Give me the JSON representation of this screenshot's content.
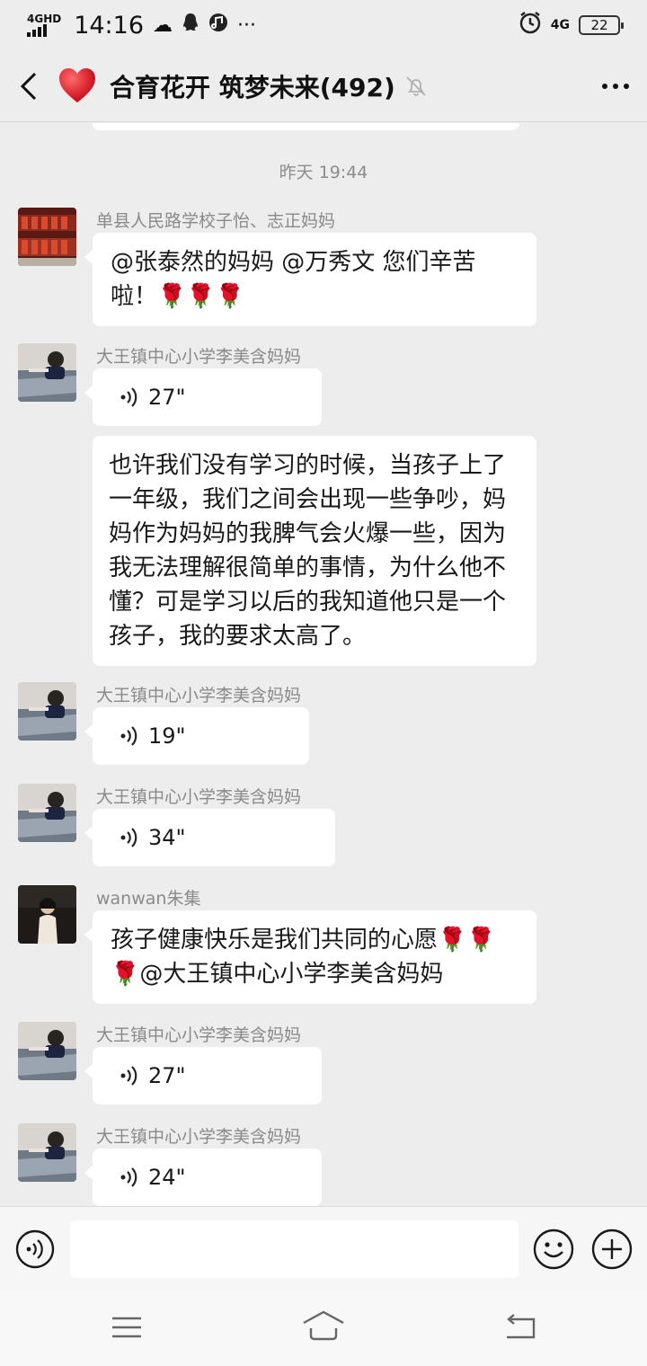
{
  "status_bar": {
    "network": "4GHD",
    "time": "14:16",
    "icons": [
      "weather-icon",
      "qq-icon",
      "music-icon",
      "more-dots"
    ],
    "mobile_data": "4G",
    "battery": "22"
  },
  "header": {
    "title": "合育花开 筑梦未来(492)",
    "muted": true
  },
  "chat": {
    "timestamp": "昨天 19:44",
    "messages": [
      {
        "sender": "单县人民路学校子怡、志正妈妈",
        "type": "text",
        "lines": [
          "@张泰然的妈妈 @万秀文  您们辛苦",
          "啦！🌹🌹🌹"
        ]
      },
      {
        "sender": "大王镇中心小学李美含妈妈",
        "type": "voice",
        "duration": "27\""
      },
      {
        "sender": "",
        "type": "text",
        "lines": [
          "也许我们没有学习的时候，当孩子上了",
          "一年级，我们之间会出现一些争吵，妈",
          "妈作为妈妈的我脾气会火爆一些，因为",
          "我无法理解很简单的事情，为什么他不",
          "懂？可是学习以后的我知道他只是一个",
          "孩子，我的要求太高了。"
        ]
      },
      {
        "sender": "大王镇中心小学李美含妈妈",
        "type": "voice",
        "duration": "19\""
      },
      {
        "sender": "大王镇中心小学李美含妈妈",
        "type": "voice",
        "duration": "34\""
      },
      {
        "sender": "wanwan朱集",
        "type": "text",
        "lines": [
          "孩子健康快乐是我们共同的心愿🌹🌹",
          "🌹@大王镇中心小学李美含妈妈"
        ]
      },
      {
        "sender": "大王镇中心小学李美含妈妈",
        "type": "voice",
        "duration": "27\""
      },
      {
        "sender": "大王镇中心小学李美含妈妈",
        "type": "voice",
        "duration": "24\""
      }
    ]
  },
  "input": {
    "value": "",
    "placeholder": ""
  },
  "colors": {
    "background": "#ededed",
    "bubble": "#ffffff",
    "sender_text": "#8a8a8a"
  }
}
